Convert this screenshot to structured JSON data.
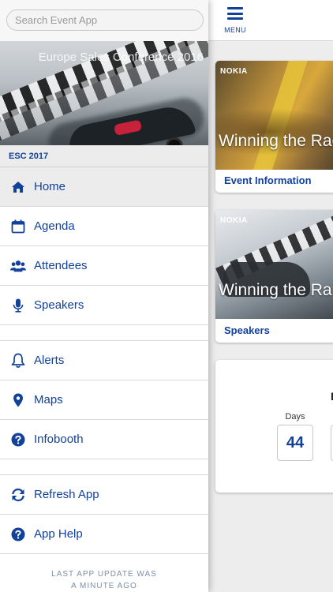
{
  "colors": {
    "accent": "#12419a",
    "active_row": "#ececec",
    "divider": "#d9d9d9"
  },
  "search": {
    "placeholder": "Search Event App",
    "value": ""
  },
  "banner": {
    "title": "Europe Sales Conference 2016"
  },
  "event": {
    "short_name": "ESC 2017"
  },
  "nav": {
    "items": [
      {
        "label": "Home",
        "icon": "home-icon",
        "active": true
      },
      {
        "label": "Agenda",
        "icon": "calendar-icon"
      },
      {
        "label": "Attendees",
        "icon": "users-icon"
      },
      {
        "label": "Speakers",
        "icon": "microphone-icon"
      },
      {
        "label": "Alerts",
        "icon": "bell-icon"
      },
      {
        "label": "Maps",
        "icon": "map-pin-icon"
      },
      {
        "label": "Infobooth",
        "icon": "question-icon"
      },
      {
        "label": "Refresh App",
        "icon": "refresh-icon"
      },
      {
        "label": "App Help",
        "icon": "question-icon"
      }
    ]
  },
  "footer": {
    "line1": "LAST APP UPDATE WAS",
    "line2": "A MINUTE AGO"
  },
  "header": {
    "menu_label": "MENU"
  },
  "cards": [
    {
      "brand": "NOKIA",
      "overlay": "Winning the Rac",
      "caption": "Event Information"
    },
    {
      "brand": "NOKIA",
      "overlay": "Winning the Ra",
      "caption": "Speakers"
    }
  ],
  "countdown": {
    "title_fragment": "E",
    "days_label": "Days",
    "days_value": "44"
  }
}
